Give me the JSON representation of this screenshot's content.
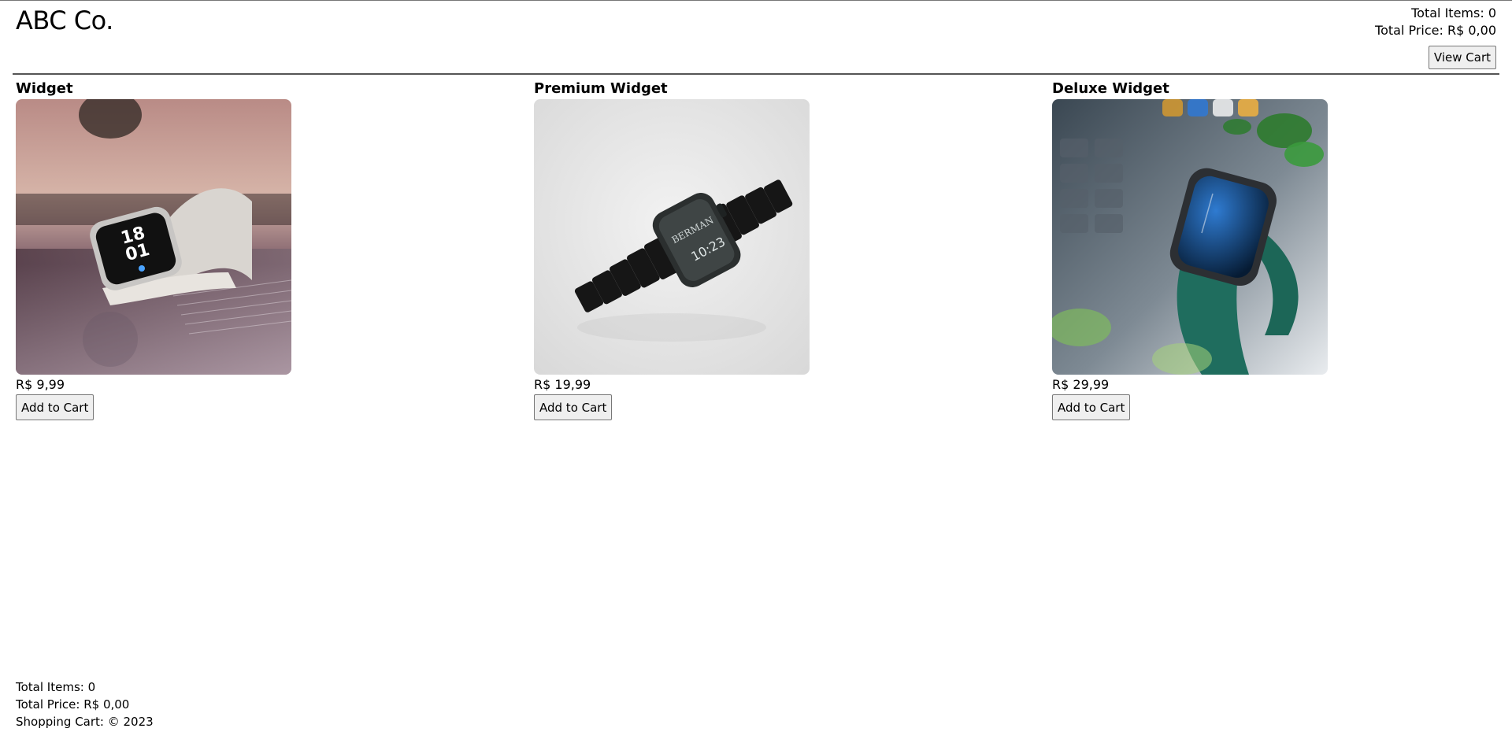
{
  "header": {
    "brand": "ABC Co.",
    "total_items": "Total Items: 0",
    "total_price": "Total Price: R$ 0,00",
    "view_cart_label": "View Cart"
  },
  "products": [
    {
      "name": "Widget",
      "price": "R$ 9,99",
      "button_label": "Add to Cart",
      "image_icon": "smartwatch-white-band-image"
    },
    {
      "name": "Premium Widget",
      "price": "R$ 19,99",
      "button_label": "Add to Cart",
      "image_icon": "smartwatch-black-metal-band-image"
    },
    {
      "name": "Deluxe Widget",
      "price": "R$ 29,99",
      "button_label": "Add to Cart",
      "image_icon": "smartwatch-green-leather-band-image"
    }
  ],
  "footer": {
    "total_items": "Total Items: 0",
    "total_price": "Total Price: R$ 0,00",
    "copyright": "Shopping Cart: © 2023"
  }
}
